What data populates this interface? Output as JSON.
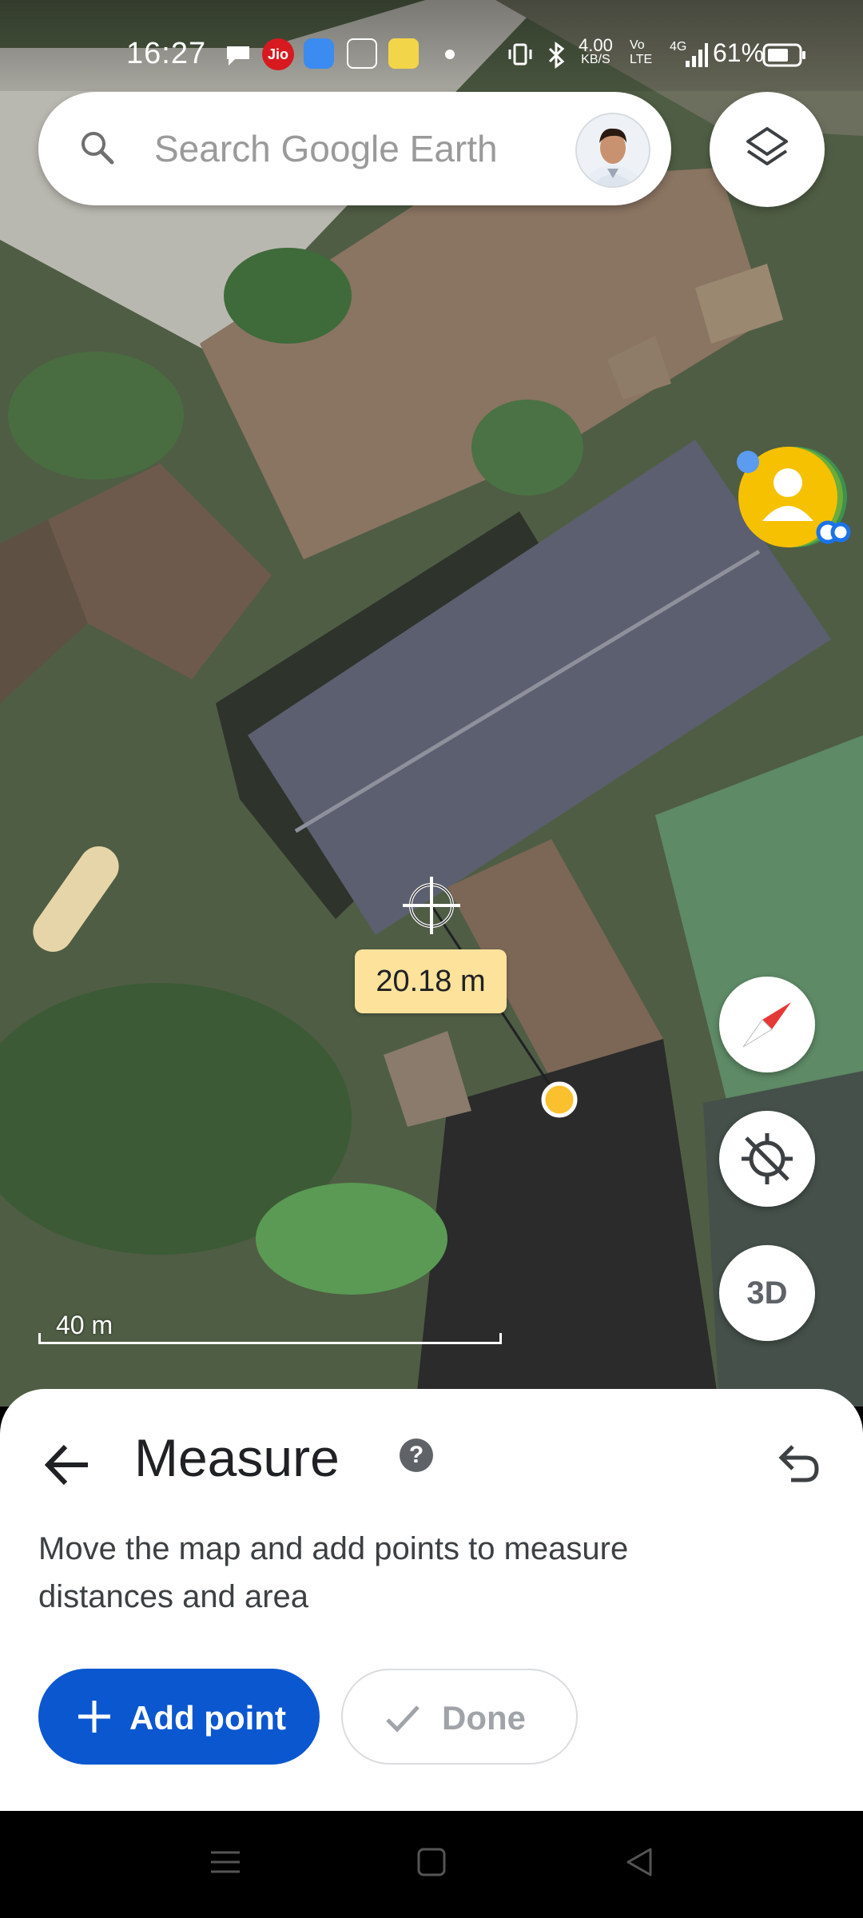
{
  "status_bar": {
    "time": "16:27",
    "net_speed": "4.00",
    "net_unit": "KB/S",
    "battery": "61%",
    "carrier_badge": "Jio",
    "network": "4G"
  },
  "search": {
    "placeholder": "Search Google Earth"
  },
  "map": {
    "measurement": "20.18 m",
    "scale_label": "40 m"
  },
  "controls": {
    "btn_3d": "3D"
  },
  "measure_sheet": {
    "title": "Measure",
    "help": "?",
    "instruction": "Move the map and add points to measure distances and area",
    "add_point_label": "Add point",
    "done_label": "Done"
  },
  "colors": {
    "primary_button": "#0b57d0",
    "label_bg": "#fde29b",
    "marker": "#fbc02d"
  }
}
